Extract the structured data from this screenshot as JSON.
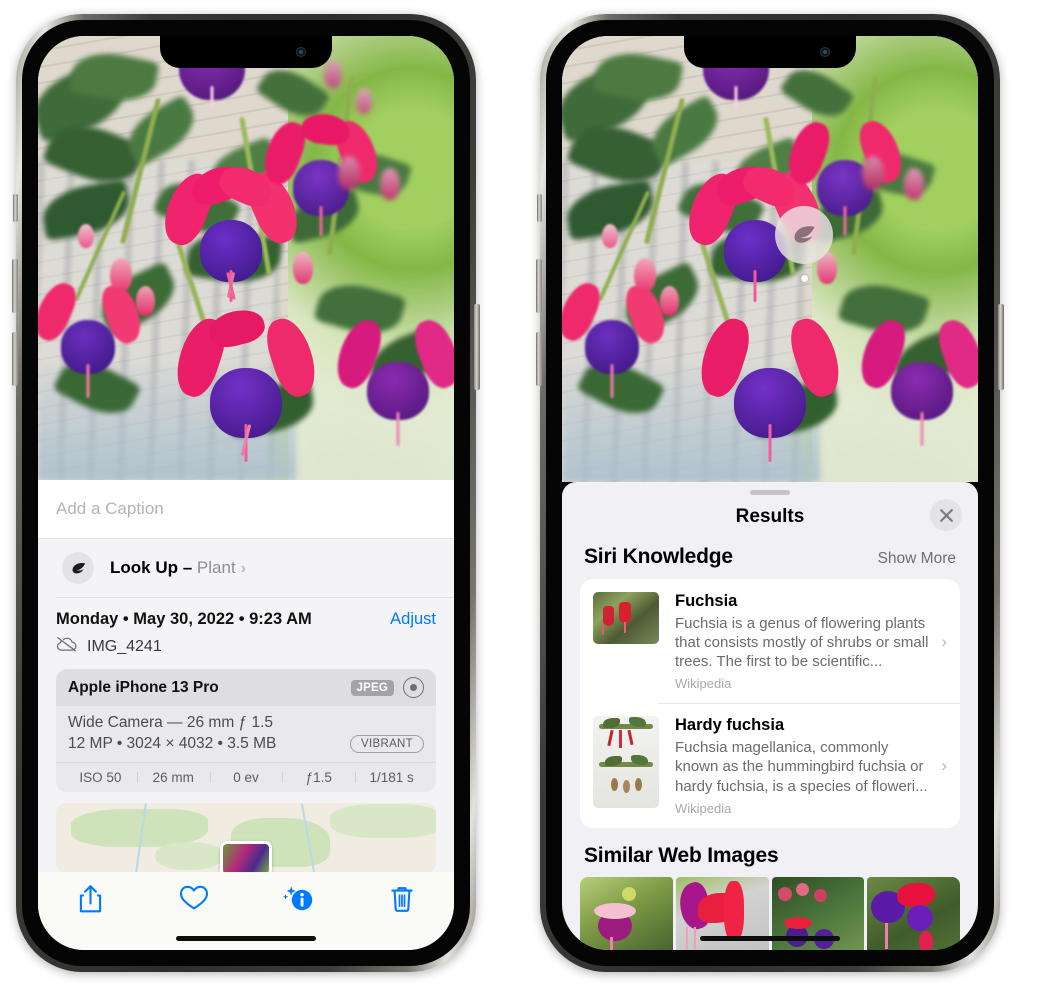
{
  "left_phone": {
    "photo": {
      "alt": "fuchsia-flowers-photo"
    },
    "caption_field": {
      "placeholder": "Add a Caption",
      "value": ""
    },
    "lookup_row": {
      "label": "Look Up – ",
      "subject": "Plant",
      "chevron": "›",
      "icon": "leaf-icon"
    },
    "info": {
      "date": "Monday • May 30, 2022 • 9:23 AM",
      "adjust_label": "Adjust",
      "filename": "IMG_4241",
      "cloud_icon": "icloud-slash-icon"
    },
    "exif": {
      "device": "Apple iPhone 13 Pro",
      "format_badge": "JPEG",
      "lens_line": "Wide Camera — 26 mm ƒ 1.5",
      "size_line": "12 MP • 3024 × 4032 • 3.5 MB",
      "style_badge": "VIBRANT",
      "stats": [
        "ISO 50",
        "26 mm",
        "0 ev",
        "ƒ1.5",
        "1/181 s"
      ]
    },
    "toolbar": [
      {
        "name": "share-button",
        "icon": "share-icon"
      },
      {
        "name": "favorite-button",
        "icon": "heart-icon"
      },
      {
        "name": "info-visual-lookup-button",
        "icon": "info-sparkle-icon"
      },
      {
        "name": "delete-button",
        "icon": "trash-icon"
      }
    ]
  },
  "right_phone": {
    "photo": {
      "alt": "fuchsia-flowers-photo"
    },
    "lens_badge": {
      "icon": "leaf-icon",
      "label": "Visual Look Up plant indicator"
    },
    "sheet": {
      "title": "Results",
      "close_icon": "close-icon",
      "sections": [
        {
          "title": "Siri Knowledge",
          "action": "Show More",
          "items": [
            {
              "title": "Fuchsia",
              "description": "Fuchsia is a genus of flowering plants that consists mostly of shrubs or small trees. The first to be scientific...",
              "source": "Wikipedia",
              "chevron": "›"
            },
            {
              "title": "Hardy fuchsia",
              "description": "Fuchsia magellanica, commonly known as the hummingbird fuchsia or hardy fuchsia, is a species of floweri...",
              "source": "Wikipedia",
              "chevron": "›"
            }
          ]
        },
        {
          "title": "Similar Web Images",
          "images": [
            "web-image-1",
            "web-image-2",
            "web-image-3",
            "web-image-4"
          ]
        }
      ]
    }
  },
  "colors": {
    "accent_blue": "#007aff",
    "sheet_bg": "#f1f0f4",
    "panel_bg": "#f4f4f6",
    "exif_bg": "#e9e9ec"
  }
}
